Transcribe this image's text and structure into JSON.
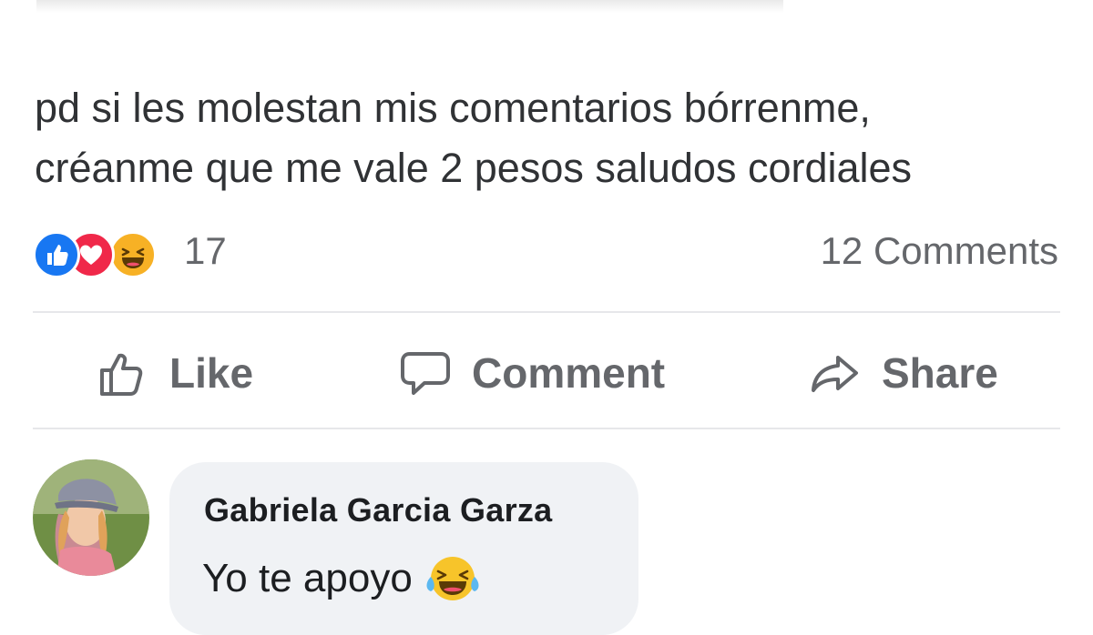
{
  "post": {
    "text_lines": [
      "pd si les molestan mis comentarios bórrenme,",
      "créanme que me vale 2 pesos  saludos cordiales"
    ]
  },
  "reactions": {
    "icons": [
      "like-icon",
      "love-icon",
      "haha-icon"
    ],
    "count": "17",
    "comments_count": "12 Comments"
  },
  "actions": {
    "like_label": "Like",
    "comment_label": "Comment",
    "share_label": "Share"
  },
  "comment": {
    "author": "Gabriela Garcia Garza",
    "text": "Yo te apoyo",
    "emoji": "laughing-tears-emoji"
  },
  "colors": {
    "like_blue": "#1877f2",
    "love_red": "#f02849",
    "haha_yellow": "#f7b125",
    "muted_text": "#65676b",
    "bubble_bg": "#f0f2f5"
  }
}
